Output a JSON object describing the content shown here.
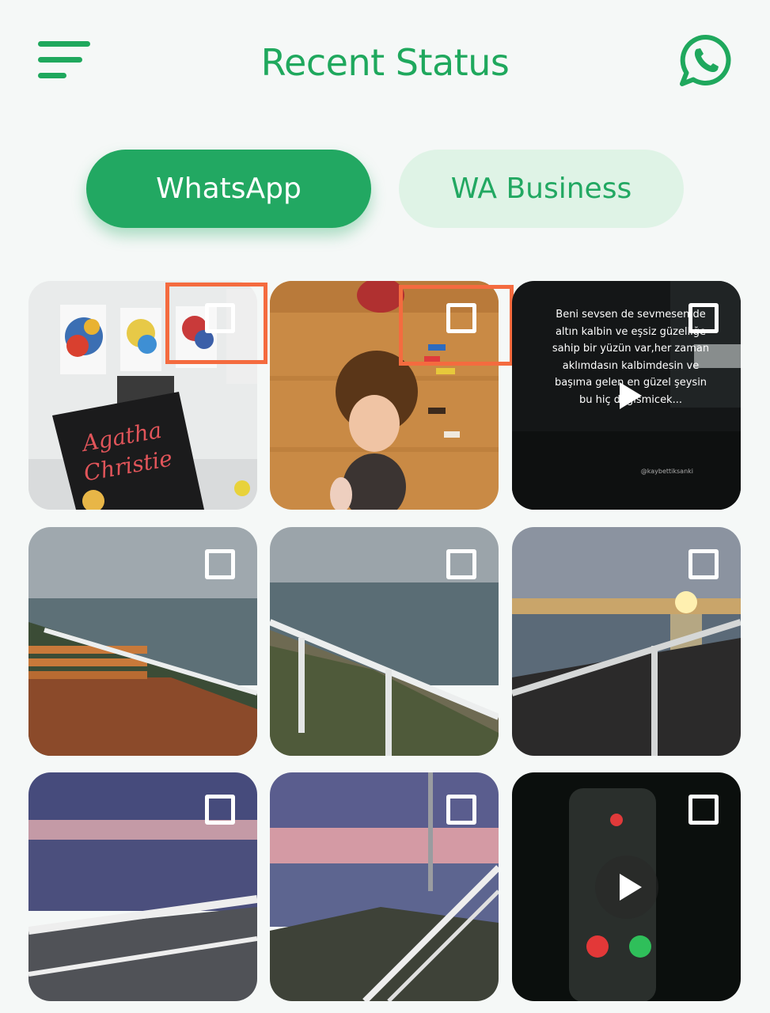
{
  "header": {
    "title": "Recent Status",
    "menu_icon": "hamburger-menu-icon",
    "whatsapp_icon": "whatsapp-icon"
  },
  "tabs": [
    {
      "label": "WhatsApp",
      "active": true
    },
    {
      "label": "WA Business",
      "active": false
    }
  ],
  "colors": {
    "brand_green": "#1fa85d",
    "tab_inactive_bg": "#dff3e6",
    "highlight": "#f46b3f",
    "background": "#f5f8f7"
  },
  "statuses": [
    {
      "type": "image",
      "scene": "living room with paintings and book",
      "book_title": "Agatha Christie",
      "checked": false
    },
    {
      "type": "image",
      "scene": "crying doll on wooden floor",
      "checked": false
    },
    {
      "type": "video",
      "caption": "Beni sevsen de sevmesen de altın kalbin ve eşsiz güzelliğe sahip bir yüzün var,her zaman aklımdasın kalbimdesin ve başıma gelen en güzel şeysin bu hiç degismicek...",
      "credit": "@kaybettiksanki",
      "checked": false
    },
    {
      "type": "image",
      "scene": "seaside terrace with wooden benches",
      "checked": false
    },
    {
      "type": "image",
      "scene": "seaside promenade with railing",
      "checked": false
    },
    {
      "type": "image",
      "scene": "sunset over the sea",
      "checked": false
    },
    {
      "type": "image",
      "scene": "dusk over the sea with railing",
      "checked": false
    },
    {
      "type": "image",
      "scene": "pink sky over the coast",
      "checked": false
    },
    {
      "type": "video",
      "scene": "dark video with phone screen",
      "checked": false
    }
  ]
}
